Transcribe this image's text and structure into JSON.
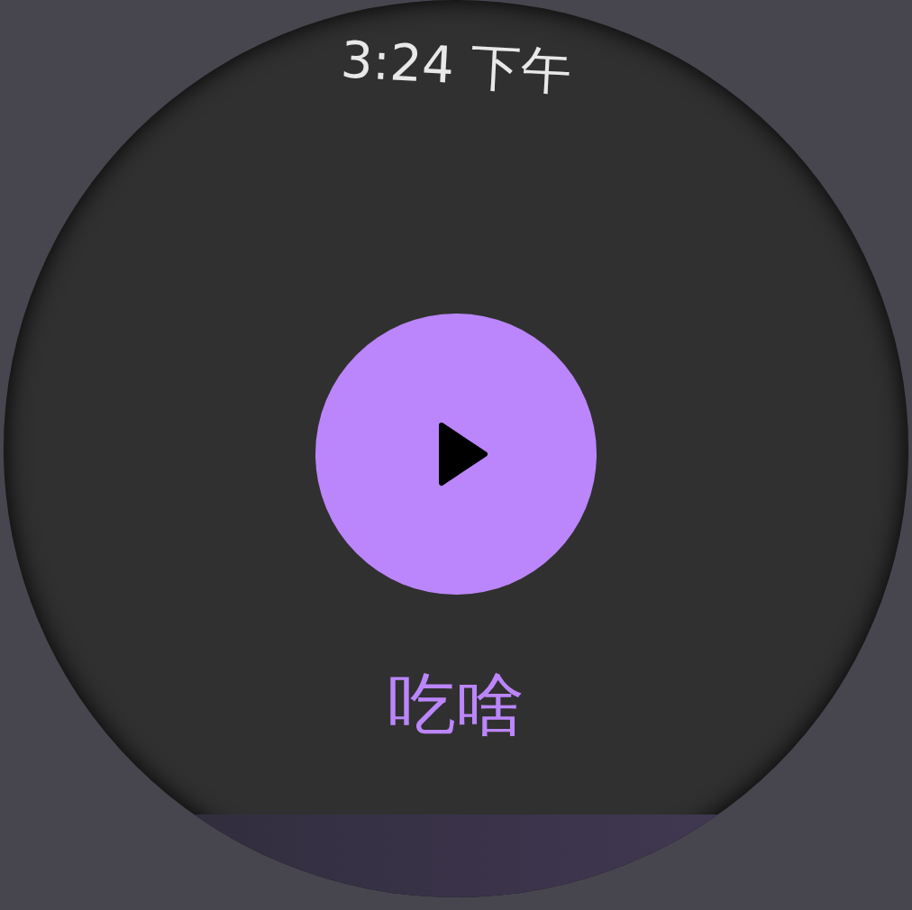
{
  "status_bar": {
    "time": "3:24 下午"
  },
  "title": "吃啥"
}
